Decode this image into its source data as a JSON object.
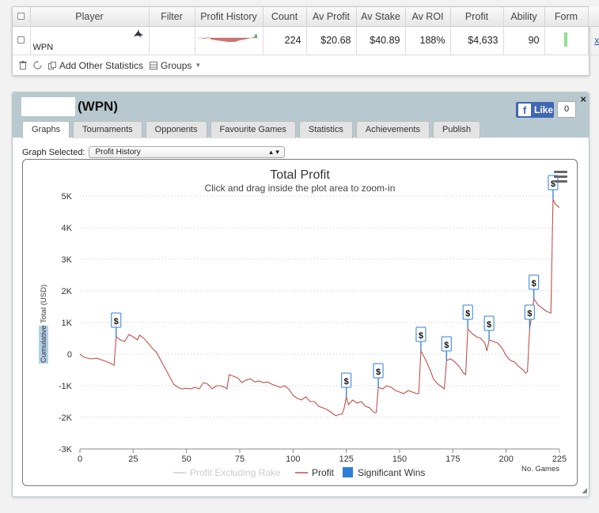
{
  "stats_table": {
    "headers": [
      "Player",
      "Filter",
      "Profit History",
      "Count",
      "Av Profit",
      "Av Stake",
      "Av ROI",
      "Profit",
      "Ability",
      "Form"
    ],
    "row": {
      "player": "WPN",
      "filter": "",
      "count": "224",
      "av_profit": "$20.68",
      "av_stake": "$40.89",
      "av_roi": "188%",
      "profit": "$4,633",
      "ability": "90",
      "remove_link": "x"
    },
    "toolbar": {
      "add_stats": "Add Other Statistics",
      "groups": "Groups"
    }
  },
  "details": {
    "title": "(WPN)",
    "fb_like": "Like",
    "fb_count": "0",
    "close": "×",
    "tabs": [
      "Graphs",
      "Tournaments",
      "Opponents",
      "Favourite Games",
      "Statistics",
      "Achievements",
      "Publish"
    ],
    "graph_selected_label": "Graph Selected:",
    "graph_selected_value": "Profit History"
  },
  "chart_data": {
    "type": "line",
    "title": "Total Profit",
    "subtitle": "Click and drag inside the plot area to zoom-in",
    "ylabel": "Cumulative Total (USD)",
    "ylabel_highlight": "Cumulative",
    "xlabel": "No. Games",
    "xlim": [
      0,
      225
    ],
    "ylim": [
      -3000,
      5000
    ],
    "x_ticks": [
      0,
      25,
      50,
      75,
      100,
      125,
      150,
      175,
      200,
      225
    ],
    "y_ticks": [
      -3000,
      -2000,
      -1000,
      0,
      1000,
      2000,
      3000,
      4000,
      5000
    ],
    "y_tick_labels": [
      "-3K",
      "-2K",
      "-1K",
      "0",
      "1K",
      "2K",
      "3K",
      "4K",
      "5K"
    ],
    "legend": [
      "Profit Excluding Rake",
      "Profit",
      "Significant Wins"
    ],
    "colors": {
      "profit": "#c0504d",
      "excl_rake": "#cccccc",
      "wins": "#2f7ed8"
    },
    "series": [
      {
        "name": "Profit",
        "points": [
          [
            0,
            0
          ],
          [
            2,
            -100
          ],
          [
            5,
            -150
          ],
          [
            8,
            -130
          ],
          [
            11,
            -200
          ],
          [
            14,
            -280
          ],
          [
            16,
            -350
          ],
          [
            17,
            550
          ],
          [
            19,
            450
          ],
          [
            21,
            400
          ],
          [
            23,
            620
          ],
          [
            25,
            550
          ],
          [
            27,
            450
          ],
          [
            28,
            600
          ],
          [
            30,
            500
          ],
          [
            32,
            350
          ],
          [
            34,
            180
          ],
          [
            36,
            50
          ],
          [
            38,
            -200
          ],
          [
            40,
            -450
          ],
          [
            42,
            -700
          ],
          [
            44,
            -950
          ],
          [
            46,
            -1050
          ],
          [
            48,
            -1100
          ],
          [
            50,
            -1080
          ],
          [
            52,
            -1100
          ],
          [
            54,
            -1050
          ],
          [
            56,
            -1100
          ],
          [
            58,
            -900
          ],
          [
            60,
            -950
          ],
          [
            62,
            -1100
          ],
          [
            64,
            -1000
          ],
          [
            66,
            -1000
          ],
          [
            68,
            -1050
          ],
          [
            69,
            -1100
          ],
          [
            70,
            -650
          ],
          [
            72,
            -700
          ],
          [
            74,
            -750
          ],
          [
            76,
            -900
          ],
          [
            78,
            -820
          ],
          [
            80,
            -780
          ],
          [
            82,
            -880
          ],
          [
            84,
            -850
          ],
          [
            86,
            -900
          ],
          [
            88,
            -880
          ],
          [
            90,
            -950
          ],
          [
            92,
            -1000
          ],
          [
            94,
            -1050
          ],
          [
            96,
            -1000
          ],
          [
            98,
            -1100
          ],
          [
            100,
            -1300
          ],
          [
            102,
            -1400
          ],
          [
            104,
            -1450
          ],
          [
            106,
            -1350
          ],
          [
            108,
            -1500
          ],
          [
            110,
            -1500
          ],
          [
            112,
            -1650
          ],
          [
            114,
            -1700
          ],
          [
            116,
            -1750
          ],
          [
            118,
            -1850
          ],
          [
            120,
            -1950
          ],
          [
            122,
            -1900
          ],
          [
            123,
            -1900
          ],
          [
            124,
            -1700
          ],
          [
            125,
            -1350
          ],
          [
            126,
            -1600
          ],
          [
            128,
            -1450
          ],
          [
            130,
            -1550
          ],
          [
            132,
            -1500
          ],
          [
            134,
            -1650
          ],
          [
            136,
            -1700
          ],
          [
            138,
            -1850
          ],
          [
            139,
            -1850
          ],
          [
            140,
            -1050
          ],
          [
            142,
            -1100
          ],
          [
            144,
            -1000
          ],
          [
            146,
            -1050
          ],
          [
            148,
            -1150
          ],
          [
            150,
            -1200
          ],
          [
            152,
            -1250
          ],
          [
            154,
            -1150
          ],
          [
            156,
            -1200
          ],
          [
            158,
            -1250
          ],
          [
            159,
            -1250
          ],
          [
            160,
            100
          ],
          [
            162,
            -150
          ],
          [
            164,
            -450
          ],
          [
            166,
            -800
          ],
          [
            168,
            -950
          ],
          [
            170,
            -1050
          ],
          [
            171,
            -1100
          ],
          [
            172,
            -200
          ],
          [
            174,
            -150
          ],
          [
            176,
            -250
          ],
          [
            178,
            -400
          ],
          [
            180,
            -600
          ],
          [
            181,
            -650
          ],
          [
            182,
            800
          ],
          [
            184,
            650
          ],
          [
            186,
            550
          ],
          [
            188,
            500
          ],
          [
            190,
            350
          ],
          [
            191,
            100
          ],
          [
            192,
            450
          ],
          [
            194,
            400
          ],
          [
            196,
            350
          ],
          [
            198,
            200
          ],
          [
            200,
            -50
          ],
          [
            202,
            -200
          ],
          [
            204,
            -250
          ],
          [
            206,
            -400
          ],
          [
            208,
            -500
          ],
          [
            209,
            -600
          ],
          [
            210,
            -550
          ],
          [
            211,
            800
          ],
          [
            212,
            1200
          ],
          [
            213,
            1750
          ],
          [
            215,
            1550
          ],
          [
            217,
            1450
          ],
          [
            219,
            1350
          ],
          [
            221,
            1300
          ],
          [
            222,
            4900
          ],
          [
            223,
            4750
          ],
          [
            225,
            4633
          ]
        ]
      }
    ],
    "significant_wins": [
      [
        17,
        550
      ],
      [
        125,
        -1350
      ],
      [
        140,
        -1050
      ],
      [
        160,
        100
      ],
      [
        172,
        -200
      ],
      [
        182,
        800
      ],
      [
        192,
        450
      ],
      [
        211,
        800
      ],
      [
        213,
        1750
      ],
      [
        222,
        4900
      ]
    ],
    "win_marker_label": "$",
    "grid": true,
    "legend_position": "bottom"
  }
}
